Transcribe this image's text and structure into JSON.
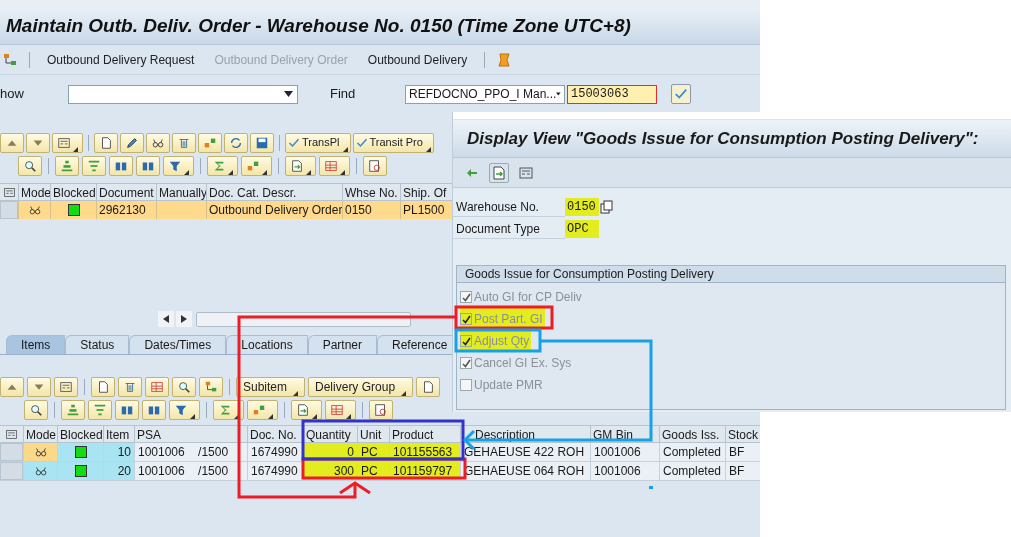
{
  "window": {
    "title": "Maintain Outb. Deliv. Order - Warehouse No. 0150 (Time Zone UTC+8)"
  },
  "menu": [
    {
      "label": "Outbound Delivery Request",
      "disabled": false
    },
    {
      "label": "Outbound Delivery Order",
      "disabled": true
    },
    {
      "label": "Outbound Delivery",
      "disabled": false
    }
  ],
  "search": {
    "show_label": "how",
    "find_label": "Find",
    "find_field": "REFDOCNO_PPO_I Man...",
    "find_value": "15003063"
  },
  "toolbar_buttons": [
    "TransPl",
    "Transit Pro"
  ],
  "header_table": {
    "columns": [
      {
        "label": "Mode",
        "kind": "mode"
      },
      {
        "label": "Blocked",
        "kind": "status"
      },
      {
        "label": "Document",
        "kind": "text"
      },
      {
        "label": "Manually",
        "kind": "text"
      },
      {
        "label": "Doc. Cat. Descr.",
        "kind": "text"
      },
      {
        "label": "Whse No.",
        "kind": "text"
      },
      {
        "label": "Ship. Of",
        "kind": "text"
      }
    ],
    "rows": [
      {
        "selected": true,
        "cells": [
          null,
          null,
          "2962130",
          null,
          "Outbound Delivery Order",
          "0150",
          "PL1500"
        ]
      }
    ]
  },
  "tabs": [
    {
      "label": "Items",
      "selected": true
    },
    {
      "label": "Status",
      "selected": false
    },
    {
      "label": "Dates/Times",
      "selected": false
    },
    {
      "label": "Locations",
      "selected": false
    },
    {
      "label": "Partner",
      "selected": false
    },
    {
      "label": "Reference",
      "selected": false
    }
  ],
  "item_buttons": [
    "Subitem",
    "Delivery Group"
  ],
  "items_table": {
    "columns": [
      {
        "label": "Mode",
        "kind": "mode"
      },
      {
        "label": "Blocked",
        "kind": "status"
      },
      {
        "label": "Item",
        "kind": "number"
      },
      {
        "label": "PSA",
        "kind": "text"
      },
      {
        "label": "Doc. No.",
        "kind": "text"
      },
      {
        "label": "Quantity",
        "kind": "number"
      },
      {
        "label": "Unit",
        "kind": "text"
      },
      {
        "label": "Product",
        "kind": "text"
      },
      {
        "label": "Description",
        "kind": "text"
      },
      {
        "label": "GM Bin",
        "kind": "text"
      },
      {
        "label": "Goods Iss.",
        "kind": "text"
      },
      {
        "label": "Stock",
        "kind": "text"
      }
    ],
    "rows": [
      {
        "current": true,
        "highlighted": true,
        "cells": [
          null,
          null,
          "10",
          "1001006    /1500",
          "1674990",
          "0",
          "PC",
          "101155563",
          "GEHAEUSE 422 ROH",
          "1001006",
          "Completed",
          "BF"
        ]
      },
      {
        "current": false,
        "highlighted": true,
        "cells": [
          null,
          null,
          "20",
          "1001006    /1500",
          "1674990",
          "300",
          "PC",
          "101159797",
          "GEHAEUSE 064 ROH",
          "1001006",
          "Completed",
          "BF"
        ]
      }
    ]
  },
  "dialog": {
    "title": "Display View \"Goods Issue for Consumption Posting Delivery\":",
    "fields": [
      {
        "label": "Warehouse No.",
        "value": "0150",
        "highlighted": true
      },
      {
        "label": "Document Type",
        "value": "OPC",
        "highlighted": true
      }
    ],
    "group": {
      "title": "Goods Issue for Consumption Posting Delivery",
      "options": [
        {
          "label": "Auto GI for CP Deliv",
          "checked": true,
          "disabled": true,
          "highlighted": false
        },
        {
          "label": "Post Part. GI",
          "checked": true,
          "disabled": true,
          "highlighted": true
        },
        {
          "label": "Adjust Qty",
          "checked": true,
          "disabled": true,
          "highlighted": true
        },
        {
          "label": "Cancel GI Ex. Sys",
          "checked": true,
          "disabled": true,
          "highlighted": false
        },
        {
          "label": "Update PMR",
          "checked": false,
          "disabled": true,
          "highlighted": false
        }
      ]
    }
  }
}
